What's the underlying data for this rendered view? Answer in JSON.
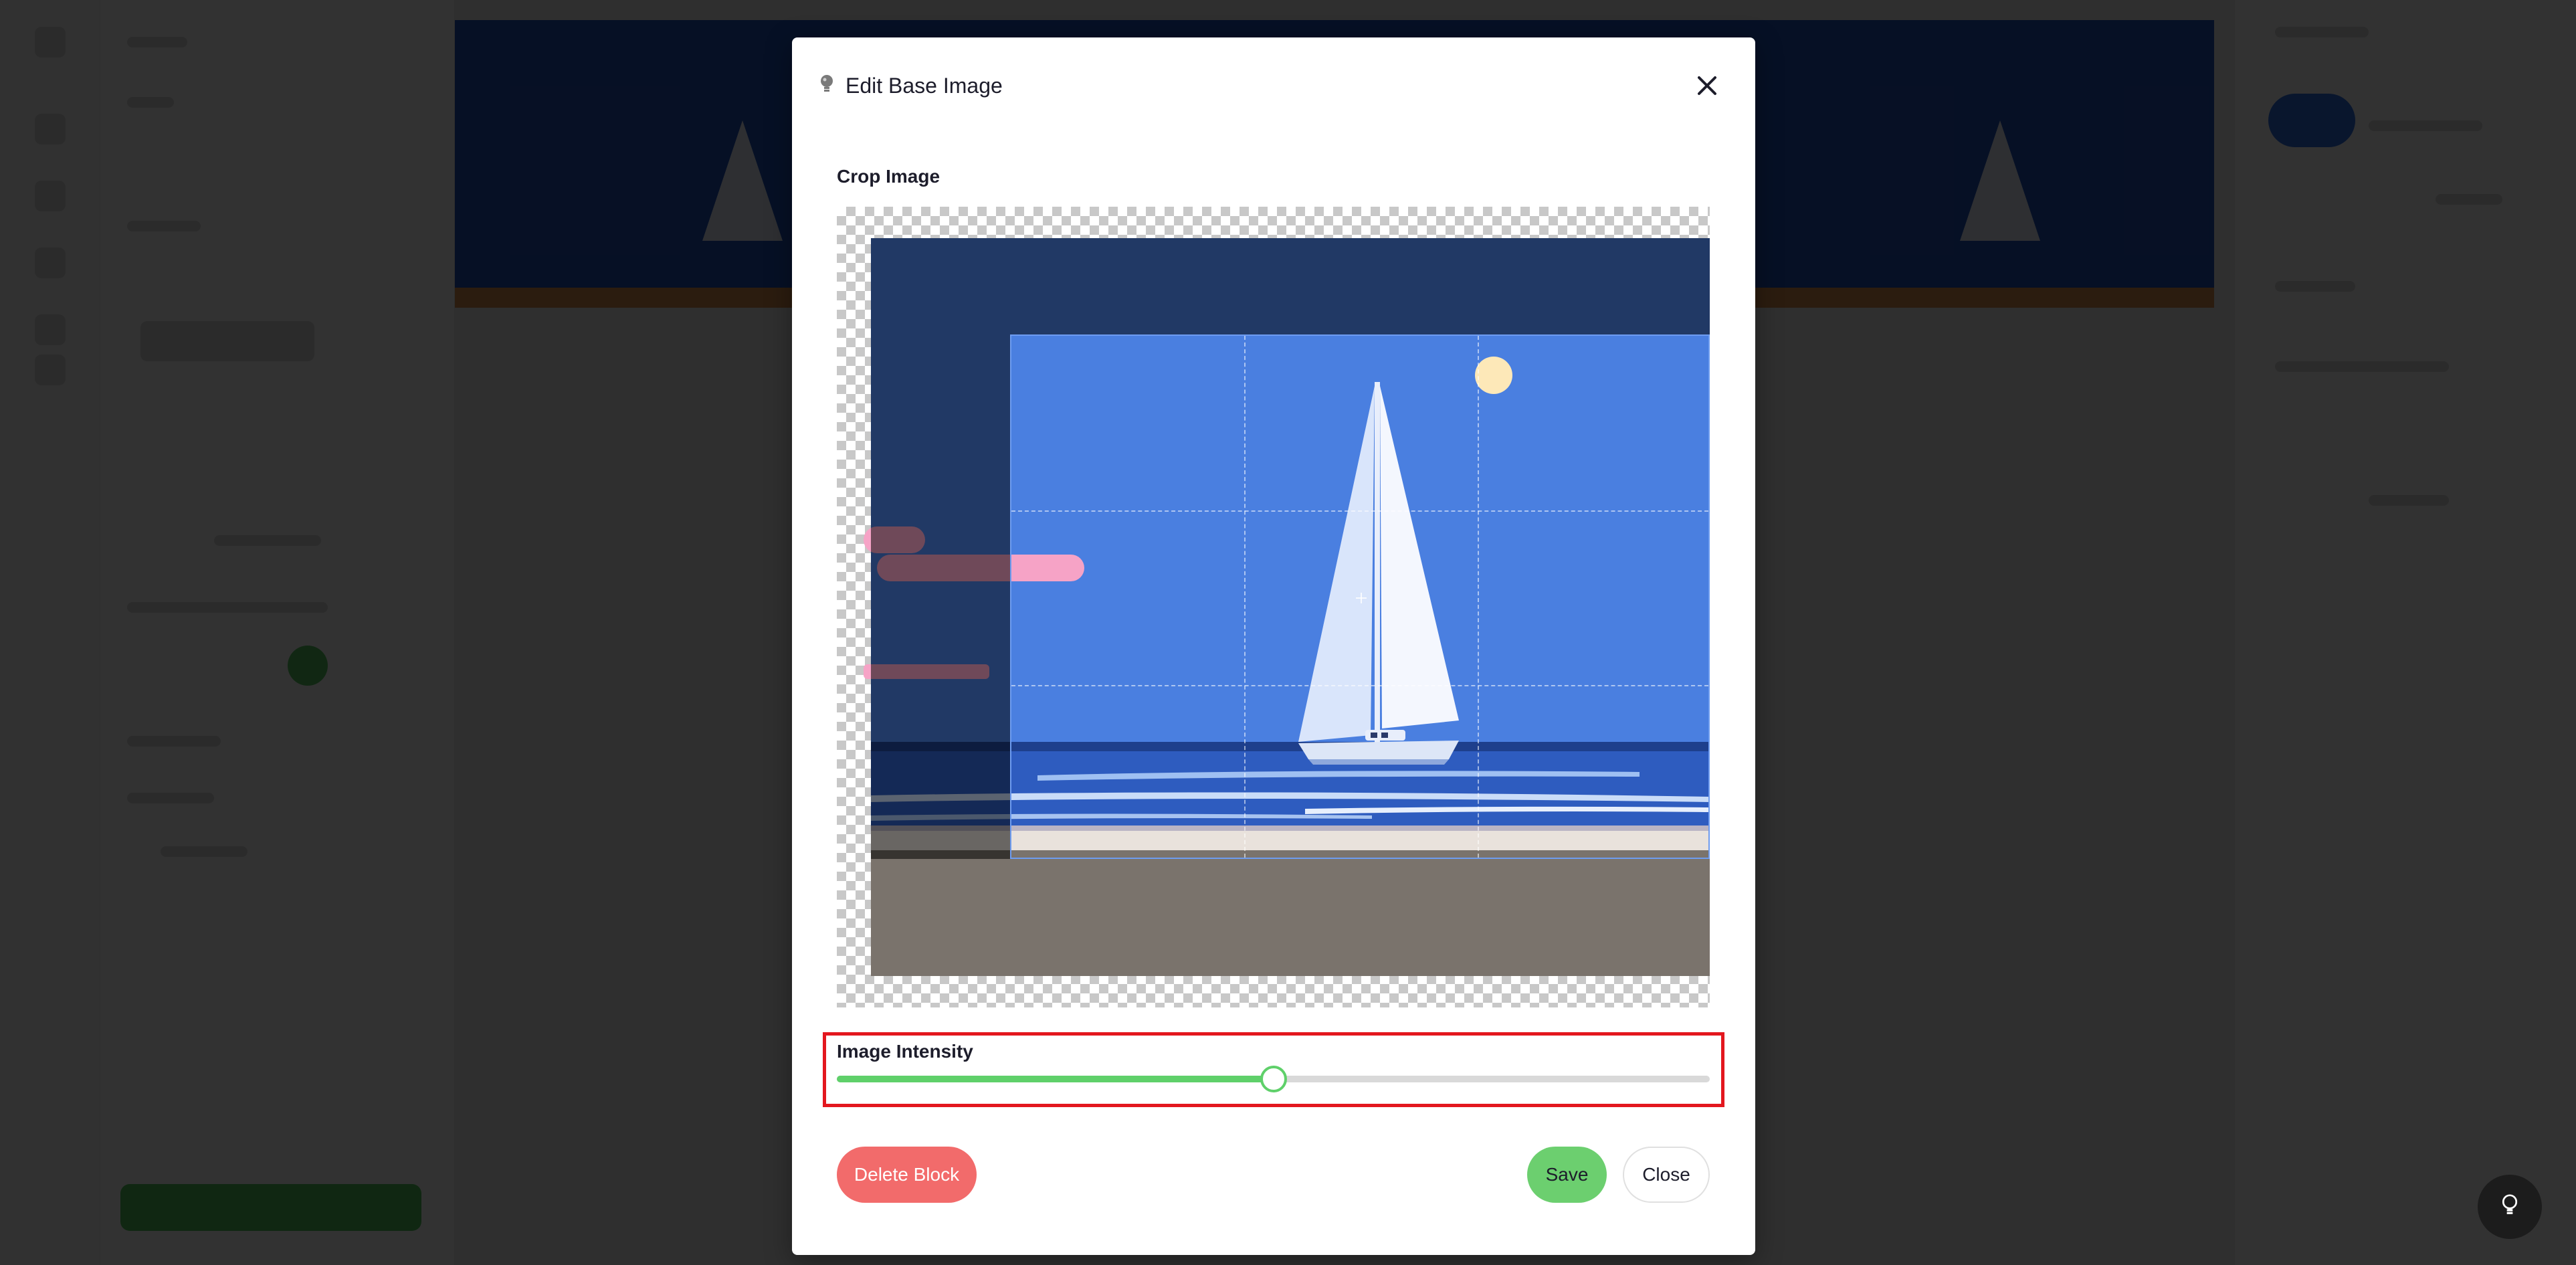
{
  "modal": {
    "title": "Edit Base Image",
    "title_icon": "lightbulb-icon",
    "close_icon": "close-icon"
  },
  "crop": {
    "label": "Crop Image"
  },
  "intensity": {
    "label": "Image Intensity",
    "value_fraction": 0.5
  },
  "buttons": {
    "delete_label": "Delete Block",
    "save_label": "Save",
    "close_label": "Close"
  },
  "help": {
    "icon": "lightbulb-icon"
  },
  "colors": {
    "accent_green": "#5fd06a",
    "delete_red": "#f26b6b",
    "highlight_red": "#e3171e",
    "image_sky": "#4a7fe0"
  }
}
